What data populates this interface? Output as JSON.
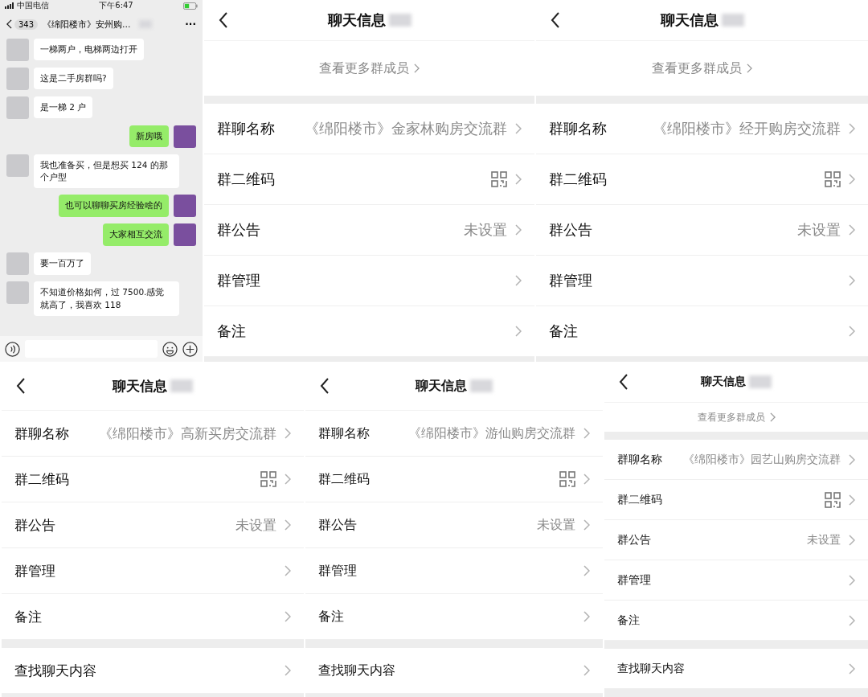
{
  "chat": {
    "status_bar": {
      "carrier": "中国电信",
      "time": "下午6:47"
    },
    "header": {
      "back_count": "343",
      "title": "《绵阳楼市》安州购...",
      "more": "···"
    },
    "messages": [
      {
        "kind": "incoming",
        "text": "一梯两户，电梯两边打开"
      },
      {
        "kind": "incoming",
        "text": "这是二手房群吗?"
      },
      {
        "kind": "incoming",
        "text": "是一梯 2 户"
      },
      {
        "kind": "outgoing",
        "text": "新房哦"
      },
      {
        "kind": "incoming",
        "text": "我也准备买，但是想买 124 的那个户型"
      },
      {
        "kind": "outgoing",
        "text": "也可以聊聊买房经验啥的"
      },
      {
        "kind": "outgoing",
        "text": "大家相互交流"
      },
      {
        "kind": "incoming",
        "text": "要一百万了"
      },
      {
        "kind": "incoming",
        "text": "不知道价格如何，过 7500.感觉就高了，我喜欢 118"
      }
    ]
  },
  "info_panels": [
    {
      "title": "聊天信息",
      "show_more": "查看更多群成员",
      "rows": [
        {
          "label": "群聊名称",
          "kind": "value",
          "value": "《绵阳楼市》金家林购房交流群"
        },
        {
          "label": "群二维码",
          "kind": "qr"
        },
        {
          "label": "群公告",
          "kind": "value",
          "value": "未设置"
        },
        {
          "label": "群管理",
          "kind": "plain"
        },
        {
          "label": "备注",
          "kind": "plain"
        }
      ]
    },
    {
      "title": "聊天信息",
      "show_more": "查看更多群成员",
      "rows": [
        {
          "label": "群聊名称",
          "kind": "value",
          "value": "《绵阳楼市》经开购房交流群"
        },
        {
          "label": "群二维码",
          "kind": "qr"
        },
        {
          "label": "群公告",
          "kind": "value",
          "value": "未设置"
        },
        {
          "label": "群管理",
          "kind": "plain"
        },
        {
          "label": "备注",
          "kind": "plain"
        }
      ]
    },
    {
      "title": "聊天信息",
      "rows": [
        {
          "label": "群聊名称",
          "kind": "value",
          "value": "《绵阳楼市》高新买房交流群"
        },
        {
          "label": "群二维码",
          "kind": "qr"
        },
        {
          "label": "群公告",
          "kind": "value",
          "value": "未设置"
        },
        {
          "label": "群管理",
          "kind": "plain"
        },
        {
          "label": "备注",
          "kind": "plain"
        }
      ],
      "footer_rows": [
        {
          "label": "查找聊天内容",
          "kind": "plain"
        }
      ]
    },
    {
      "title": "聊天信息",
      "rows": [
        {
          "label": "群聊名称",
          "kind": "value",
          "value": "《绵阳楼市》游仙购房交流群"
        },
        {
          "label": "群二维码",
          "kind": "qr"
        },
        {
          "label": "群公告",
          "kind": "value",
          "value": "未设置"
        },
        {
          "label": "群管理",
          "kind": "plain"
        },
        {
          "label": "备注",
          "kind": "plain"
        }
      ],
      "footer_rows": [
        {
          "label": "查找聊天内容",
          "kind": "plain"
        }
      ]
    },
    {
      "title": "聊天信息",
      "show_more": "查看更多群成员",
      "rows": [
        {
          "label": "群聊名称",
          "kind": "value",
          "value": "《绵阳楼市》园艺山购房交流群"
        },
        {
          "label": "群二维码",
          "kind": "qr"
        },
        {
          "label": "群公告",
          "kind": "value",
          "value": "未设置"
        },
        {
          "label": "群管理",
          "kind": "plain"
        },
        {
          "label": "备注",
          "kind": "plain"
        }
      ],
      "footer_rows": [
        {
          "label": "查找聊天内容",
          "kind": "plain"
        }
      ]
    }
  ]
}
